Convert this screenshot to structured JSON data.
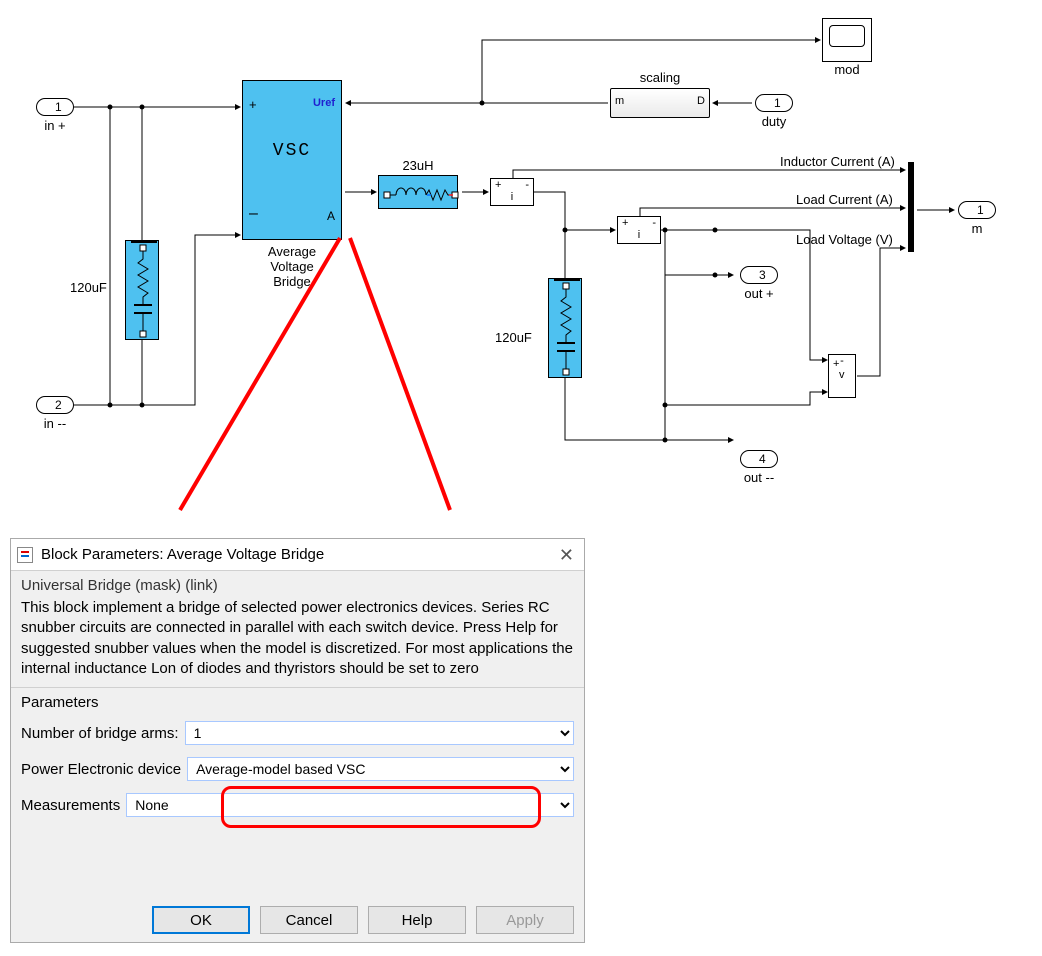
{
  "diagram": {
    "ports": {
      "in_plus": {
        "num": "1",
        "label": "in +"
      },
      "in_minus": {
        "num": "2",
        "label": "in --"
      },
      "duty": {
        "num": "1",
        "label": "duty"
      },
      "out_plus": {
        "num": "3",
        "label": "out +"
      },
      "out_minus": {
        "num": "4",
        "label": "out --"
      },
      "m": {
        "num": "1",
        "label": "m"
      }
    },
    "vsc": {
      "plus": "+",
      "minus": "–",
      "uref": "Uref",
      "a": "A",
      "title": "VSC",
      "caption": "Average\nVoltage\nBridge"
    },
    "cap1": {
      "label": "120uF"
    },
    "cap2": {
      "label": "120uF"
    },
    "inductor": {
      "label": "23uH"
    },
    "scaling": {
      "title": "scaling",
      "m": "m",
      "d": "D"
    },
    "scope": {
      "label": "mod"
    },
    "signals": {
      "ind": "Inductor Current (A)",
      "load_i": "Load Current (A)",
      "load_v": "Load Voltage (V)"
    },
    "sensors": {
      "i": "i",
      "v": "v",
      "plus": "+",
      "minus": "-"
    }
  },
  "dialog": {
    "title": "Block Parameters: Average Voltage Bridge",
    "mask_title": "Universal Bridge (mask) (link)",
    "description": "This block implement a bridge of selected power electronics devices. Series RC snubber circuits are connected in parallel with each switch device.  Press Help for suggested snubber values when the model is discretized. For most applications the internal inductance Lon of diodes and thyristors should be set to zero",
    "params_title": "Parameters",
    "fields": {
      "arms_label": "Number of bridge arms:",
      "arms_value": "1",
      "device_label": "Power Electronic device",
      "device_value": "Average-model based VSC",
      "meas_label": "Measurements",
      "meas_value": "None"
    },
    "buttons": {
      "ok": "OK",
      "cancel": "Cancel",
      "help": "Help",
      "apply": "Apply"
    }
  }
}
